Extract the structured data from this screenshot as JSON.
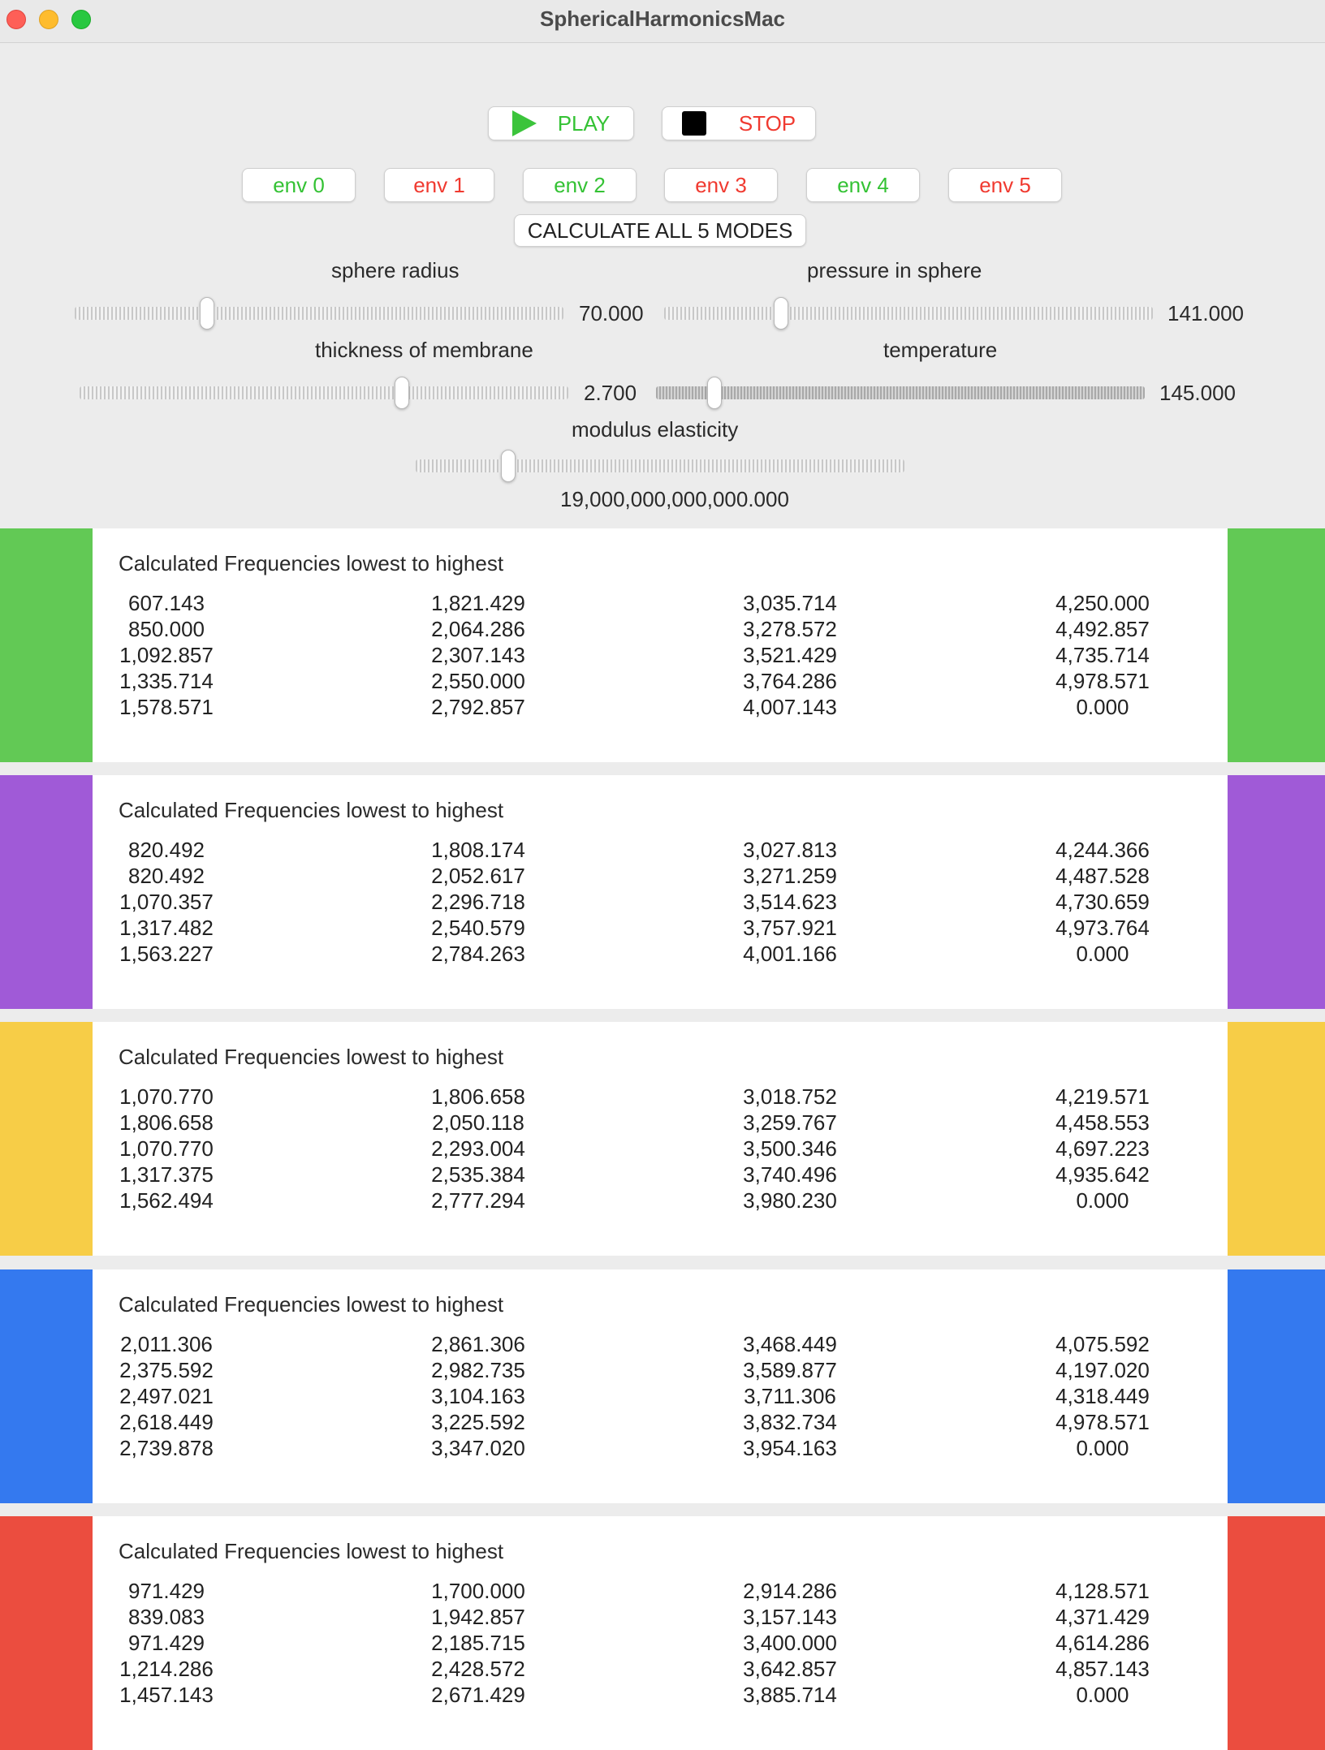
{
  "window": {
    "title": "SphericalHarmonicsMac"
  },
  "transport": {
    "play_label": "PLAY",
    "stop_label": "STOP"
  },
  "envs": [
    {
      "label": "env 0",
      "color": "#34c234"
    },
    {
      "label": "env 1",
      "color": "#f03a30"
    },
    {
      "label": "env 2",
      "color": "#34c234"
    },
    {
      "label": "env 3",
      "color": "#f03a30"
    },
    {
      "label": "env 4",
      "color": "#34c234"
    },
    {
      "label": "env 5",
      "color": "#f03a30"
    }
  ],
  "calculate_label": "CALCULATE ALL 5 MODES",
  "sliders": {
    "sphere_radius": {
      "label": "sphere radius",
      "value": "70.000",
      "fraction": 0.27
    },
    "pressure": {
      "label": "pressure in sphere",
      "value": "141.000",
      "fraction": 0.24
    },
    "thickness": {
      "label": "thickness of membrane",
      "value": "2.700",
      "fraction": 0.66
    },
    "temperature": {
      "label": "temperature",
      "value": "145.000",
      "fraction": 0.12
    },
    "modulus": {
      "label": "modulus elasticity",
      "value": "19,000,000,000,000.000",
      "fraction": 0.19
    }
  },
  "panels": [
    {
      "title": "Calculated Frequencies lowest to highest",
      "color": "#62c955",
      "columns": [
        [
          "607.143",
          "850.000",
          "1,092.857",
          "1,335.714",
          "1,578.571"
        ],
        [
          "1,821.429",
          "2,064.286",
          "2,307.143",
          "2,550.000",
          "2,792.857"
        ],
        [
          "3,035.714",
          "3,278.572",
          "3,521.429",
          "3,764.286",
          "4,007.143"
        ],
        [
          "4,250.000",
          "4,492.857",
          "4,735.714",
          "4,978.571",
          "0.000"
        ]
      ]
    },
    {
      "title": "Calculated Frequencies lowest to highest",
      "color": "#a05ad7",
      "columns": [
        [
          "820.492",
          "820.492",
          "1,070.357",
          "1,317.482",
          "1,563.227"
        ],
        [
          "1,808.174",
          "2,052.617",
          "2,296.718",
          "2,540.579",
          "2,784.263"
        ],
        [
          "3,027.813",
          "3,271.259",
          "3,514.623",
          "3,757.921",
          "4,001.166"
        ],
        [
          "4,244.366",
          "4,487.528",
          "4,730.659",
          "4,973.764",
          "0.000"
        ]
      ]
    },
    {
      "title": "Calculated Frequencies lowest to highest",
      "color": "#f7cd47",
      "columns": [
        [
          "1,070.770",
          "1,806.658",
          "1,070.770",
          "1,317.375",
          "1,562.494"
        ],
        [
          "1,806.658",
          "2,050.118",
          "2,293.004",
          "2,535.384",
          "2,777.294"
        ],
        [
          "3,018.752",
          "3,259.767",
          "3,500.346",
          "3,740.496",
          "3,980.230"
        ],
        [
          "4,219.571",
          "4,458.553",
          "4,697.223",
          "4,935.642",
          "0.000"
        ]
      ]
    },
    {
      "title": "Calculated Frequencies lowest to highest",
      "color": "#3479ef",
      "columns": [
        [
          "2,011.306",
          "2,375.592",
          "2,497.021",
          "2,618.449",
          "2,739.878"
        ],
        [
          "2,861.306",
          "2,982.735",
          "3,104.163",
          "3,225.592",
          "3,347.020"
        ],
        [
          "3,468.449",
          "3,589.877",
          "3,711.306",
          "3,832.734",
          "3,954.163"
        ],
        [
          "4,075.592",
          "4,197.020",
          "4,318.449",
          "4,978.571",
          "0.000"
        ]
      ]
    },
    {
      "title": "Calculated Frequencies lowest to highest",
      "color": "#eb4d3f",
      "columns": [
        [
          "971.429",
          "839.083",
          "971.429",
          "1,214.286",
          "1,457.143"
        ],
        [
          "1,700.000",
          "1,942.857",
          "2,185.715",
          "2,428.572",
          "2,671.429"
        ],
        [
          "2,914.286",
          "3,157.143",
          "3,400.000",
          "3,642.857",
          "3,885.714"
        ],
        [
          "4,128.571",
          "4,371.429",
          "4,614.286",
          "4,857.143",
          "0.000"
        ]
      ]
    }
  ]
}
